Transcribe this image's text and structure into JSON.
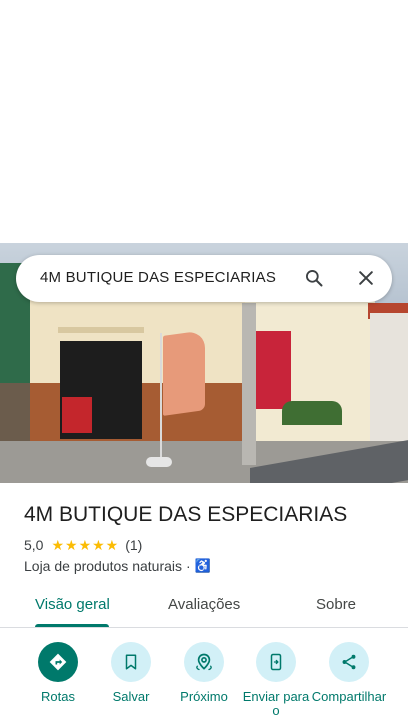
{
  "search": {
    "query": "4M BUTIQUE DAS ESPECIARIAS"
  },
  "place": {
    "title": "4M BUTIQUE DAS ESPECIARIAS",
    "rating": "5,0",
    "stars": "★★★★★",
    "review_count": "(1)",
    "category": "Loja de produtos naturais",
    "separator": "·",
    "accessibility_icon": "♿"
  },
  "tabs": [
    {
      "label": "Visão geral",
      "active": true
    },
    {
      "label": "Avaliações",
      "active": false
    },
    {
      "label": "Sobre",
      "active": false
    }
  ],
  "actions": [
    {
      "label": "Rotas",
      "icon": "directions-icon"
    },
    {
      "label": "Salvar",
      "icon": "bookmark-icon"
    },
    {
      "label": "Próximo",
      "icon": "nearby-icon"
    },
    {
      "label": "Enviar para o",
      "icon": "send-to-phone-icon"
    },
    {
      "label": "Compartilhar",
      "icon": "share-icon"
    }
  ],
  "colors": {
    "accent": "#00796b",
    "action_bg": "#d2f0f7",
    "star": "#fbbc04",
    "accessibility": "#1a73e8"
  }
}
